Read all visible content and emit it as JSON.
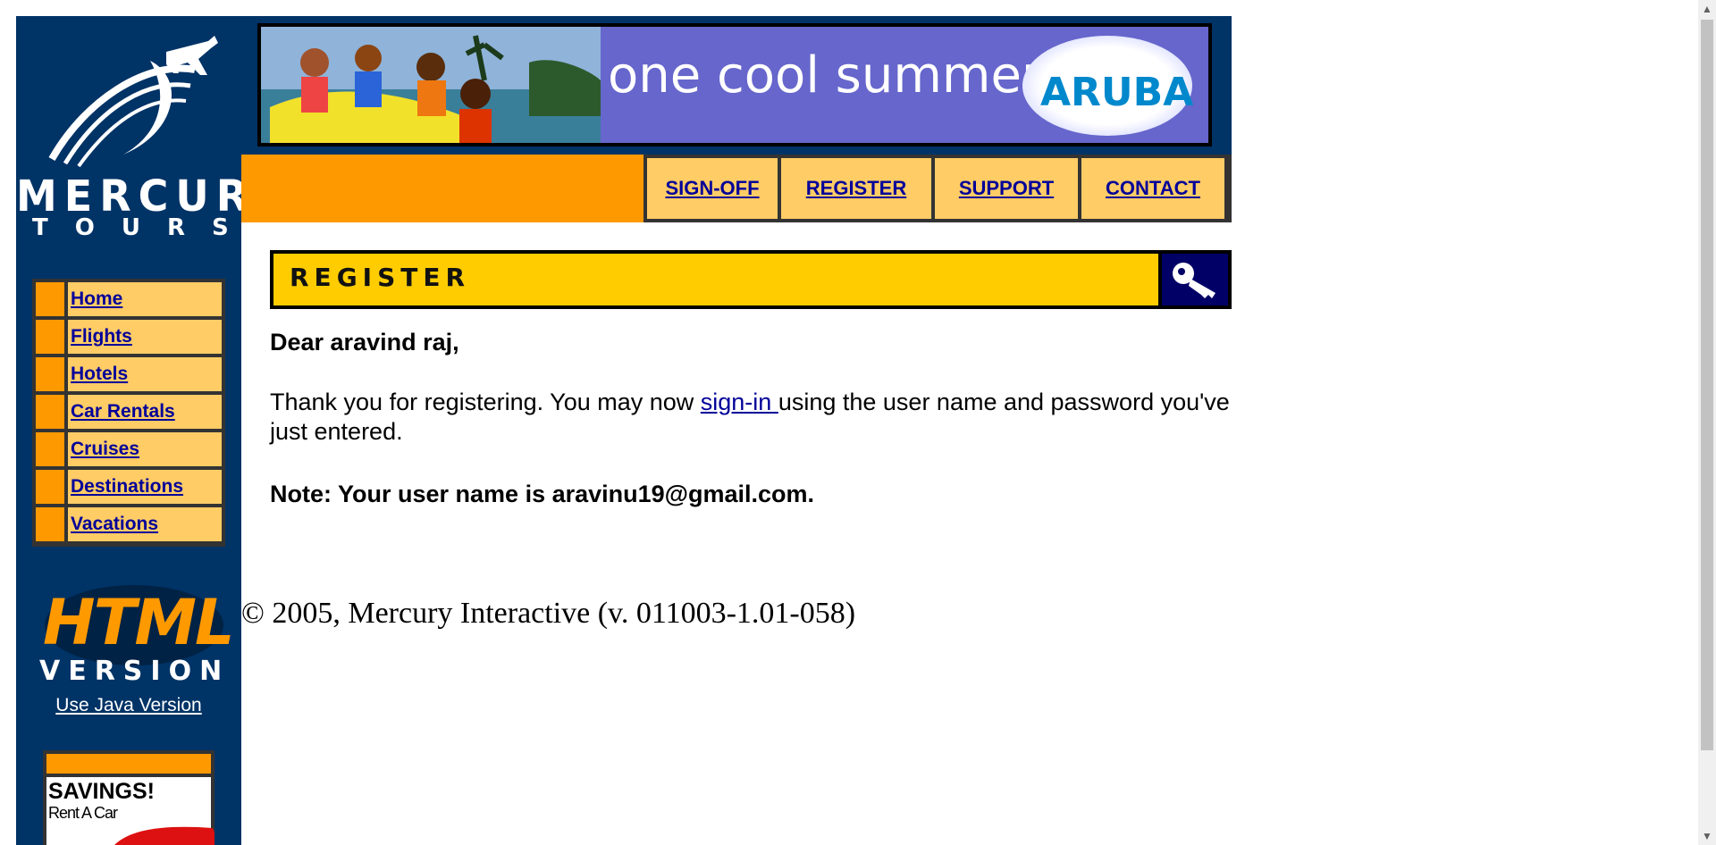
{
  "brand": {
    "name_line1": "MERCURY",
    "name_line2": "TOURS"
  },
  "banner": {
    "text": "one cool summer",
    "logo_text": "ARUBA"
  },
  "top_nav": [
    {
      "label": "SIGN-OFF"
    },
    {
      "label": "REGISTER"
    },
    {
      "label": "SUPPORT"
    },
    {
      "label": "CONTACT"
    }
  ],
  "sidebar": {
    "items": [
      {
        "label": "Home"
      },
      {
        "label": "Flights"
      },
      {
        "label": "Hotels"
      },
      {
        "label": "Car Rentals"
      },
      {
        "label": "Cruises"
      },
      {
        "label": "Destinations"
      },
      {
        "label": "Vacations"
      }
    ],
    "html_badge": "HTML",
    "version_badge": "VERSION",
    "java_link": "Use Java Version",
    "savings_title": "SAVINGS!",
    "savings_sub": "Rent A Car"
  },
  "main": {
    "section_title": "REGISTER",
    "greeting": "Dear aravind raj,",
    "thanks_prefix": "Thank you for registering. You may now ",
    "signin_link": "sign-in ",
    "thanks_suffix": "using the user name and password you've just entered.",
    "note": "Note: Your user name is aravinu19@gmail.com."
  },
  "footer": {
    "copyright": "© 2005, Mercury Interactive (v. 011003-1.01-058)"
  },
  "colors": {
    "navy": "#003366",
    "orange": "#ff9900",
    "light_orange": "#ffcc66",
    "yellow": "#ffcc00",
    "link": "#000099",
    "banner_purple": "#6666cc"
  },
  "icons": {
    "logo": "airplane-logo-icon",
    "register_key": "key-icon",
    "savings_car": "car-icon"
  }
}
